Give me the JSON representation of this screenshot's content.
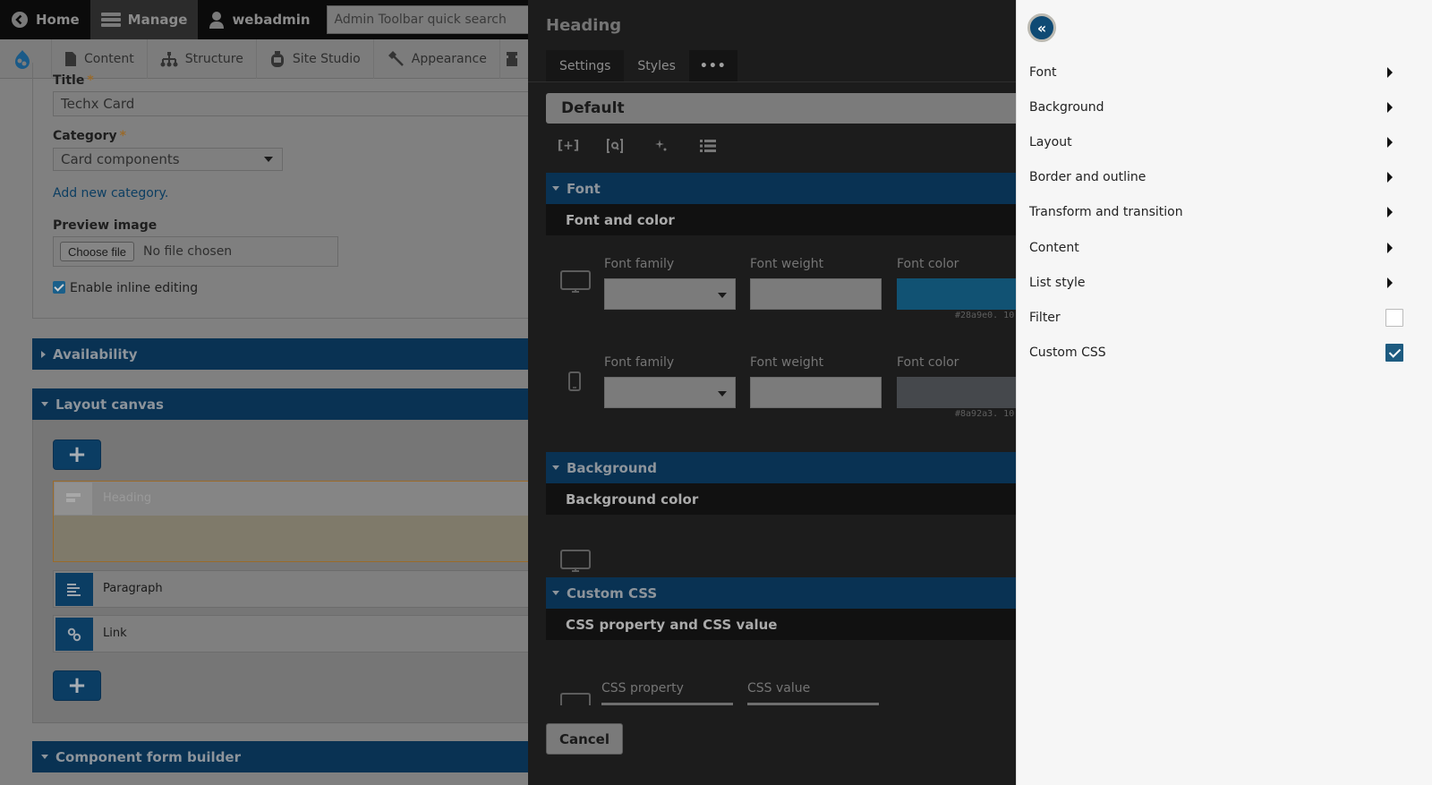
{
  "admin_toolbar": {
    "home": "Home",
    "manage": "Manage",
    "user": "webadmin",
    "search_placeholder": "Admin Toolbar quick search",
    "menu": [
      "Content",
      "Structure",
      "Site Studio",
      "Appearance"
    ]
  },
  "form": {
    "title_label": "Title",
    "title_value": "Techx Card",
    "category_label": "Category",
    "category_value": "Card components",
    "add_category_link": "Add new category.",
    "preview_image_label": "Preview image",
    "choose_file_button": "Choose file",
    "no_file_text": "No file chosen",
    "inline_editing_label": "Enable inline editing",
    "inline_editing_checked": true,
    "required_marker": "*"
  },
  "sections": {
    "availability": "Availability",
    "layout_canvas": "Layout canvas",
    "component_form_builder": "Component form builder"
  },
  "canvas": {
    "components": [
      {
        "label": "Heading",
        "icon": "heading-icon",
        "selected": true
      },
      {
        "label": "Paragraph",
        "icon": "paragraph-icon",
        "selected": false
      },
      {
        "label": "Link",
        "icon": "link-icon",
        "selected": false
      }
    ]
  },
  "modal": {
    "title": "Heading",
    "tabs": [
      "Settings",
      "Styles",
      "•••"
    ],
    "active_tab": "Styles",
    "style_selector": "Default",
    "toolbar_icons": [
      "expand-icon",
      "zoom-icon",
      "sparkle-icon",
      "list-icon"
    ],
    "font_section": {
      "title": "Font",
      "subtitle": "Font and color",
      "rows": [
        {
          "device": "desktop",
          "font_family_label": "Font family",
          "font_weight_label": "Font weight",
          "font_color_label": "Font color",
          "font_color_hex": "#28a9e0. 10",
          "color": "#115273"
        },
        {
          "device": "mobile",
          "font_family_label": "Font family",
          "font_weight_label": "Font weight",
          "font_color_label": "Font color",
          "font_color_hex": "#8a92a3. 10",
          "color": "#45484c"
        }
      ]
    },
    "background_section": {
      "title": "Background",
      "subtitle": "Background color"
    },
    "custom_css_section": {
      "title": "Custom CSS",
      "subtitle": "CSS property and CSS value",
      "css_property_label": "CSS property",
      "css_value_label": "CSS value"
    },
    "cancel_button": "Cancel"
  },
  "style_menu": {
    "items": [
      {
        "label": "Font",
        "type": "submenu"
      },
      {
        "label": "Background",
        "type": "submenu"
      },
      {
        "label": "Layout",
        "type": "submenu"
      },
      {
        "label": "Border and outline",
        "type": "submenu"
      },
      {
        "label": "Transform and transition",
        "type": "submenu"
      },
      {
        "label": "Content",
        "type": "submenu"
      },
      {
        "label": "List style",
        "type": "submenu"
      },
      {
        "label": "Filter",
        "type": "checkbox",
        "checked": false
      },
      {
        "label": "Custom CSS",
        "type": "checkbox",
        "checked": true
      }
    ]
  },
  "colors": {
    "accent_blue": "#093253",
    "checkbox_blue": "#1d5b80"
  }
}
